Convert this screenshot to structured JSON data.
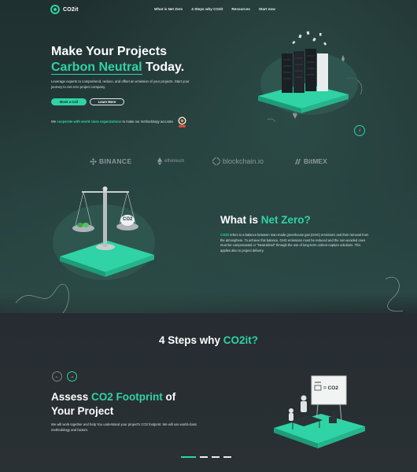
{
  "nav": {
    "brand": "CO2it",
    "links": [
      "What is Net Zero",
      "4 Steps why CO2it",
      "Resources",
      "Start now"
    ]
  },
  "hero": {
    "title_line1": "Make Your Projects",
    "title_accent": "Carbon Neutral",
    "title_rest": " Today.",
    "description": "Leverage experts to comprehend, reduce, and offset an emission of your projects. Start your journey to net zero project company.",
    "cta_primary": "Book a Call",
    "cta_secondary": "Learn More",
    "partner_prefix": "We ",
    "partner_accent": "cooperate with world class organizations",
    "partner_suffix": " to make our methodology accurate",
    "scroll_icon": "arrow-down-icon"
  },
  "brands": [
    {
      "name": "BINANCE",
      "icon": "binance-icon"
    },
    {
      "name": "ethereum",
      "icon": "ethereum-icon"
    },
    {
      "name": "blockchain.io",
      "icon": "blockchain-icon"
    },
    {
      "name": "BitMEX",
      "icon": "bitmex-icon"
    }
  ],
  "net_zero": {
    "title_prefix": "What is ",
    "title_accent": "Net Zero?",
    "desc_accent": "CO2it",
    "description": " refers to a balance between man-made greenhouse gas (GHG) emissions and their removal from the atmosphere. To achieve this balance, GHG emissions must be reduced and the non-avoided ones must be compensated or \"Neutralized\" through the use of long-term carbon-capture solutions. This applies also to project delivery.",
    "scale_label": "CO2"
  },
  "steps": {
    "title_prefix": "4 Steps why ",
    "title_accent": "CO2it?",
    "current_title_prefix": "Assess ",
    "current_title_accent": "CO2 Footprint",
    "current_title_suffix": " of",
    "current_title_line2": "Your Project",
    "current_description": "We will work together and help You understand your project's CO2 footprint. We will use world-class methodology and factors.",
    "board_label": "= CO2",
    "pages": 4,
    "active_page": 1
  },
  "colors": {
    "accent": "#2fd3a5",
    "background": "#1f2a2c",
    "muted": "#8e9799"
  }
}
